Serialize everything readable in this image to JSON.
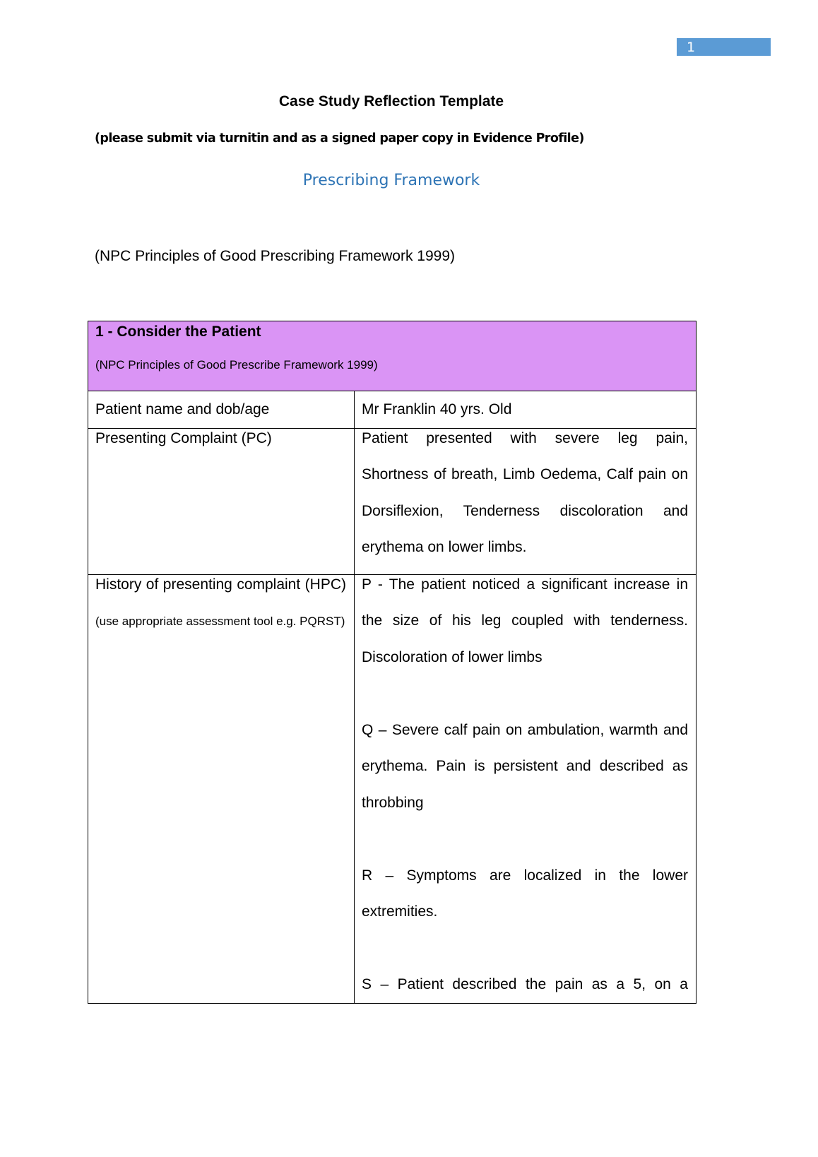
{
  "page_number": "1",
  "document": {
    "title": "Case Study Reflection Template",
    "subtitle": "(please submit via turnitin and as a signed paper copy in Evidence Profile)",
    "framework_heading": "Prescribing Framework",
    "npc_reference": "(NPC Principles of Good Prescribing Framework 1999)"
  },
  "table": {
    "section_title": "1 - Consider the Patient",
    "section_subtitle": "(NPC Principles of Good Prescribe Framework 1999)",
    "header_color": "#da94f5",
    "rows": [
      {
        "label": "Patient name and dob/age",
        "value": "Mr Franklin 40 yrs. Old"
      },
      {
        "label": "Presenting Complaint (PC)",
        "value": "Patient presented with severe leg pain, Shortness of breath, Limb Oedema, Calf pain on Dorsiflexion, Tenderness discoloration and erythema on lower limbs."
      },
      {
        "label": "History of presenting complaint (HPC)",
        "label_note": "(use appropriate assessment tool e.g. PQRST)",
        "paragraphs": [
          "P - The patient noticed a significant increase in the size of his leg coupled with tenderness. Discoloration of lower limbs",
          "Q – Severe calf pain on ambulation, warmth and erythema. Pain is persistent and described as throbbing",
          "R – Symptoms are localized in the lower extremities.",
          "S – Patient described the pain as a 5, on a"
        ]
      }
    ]
  }
}
